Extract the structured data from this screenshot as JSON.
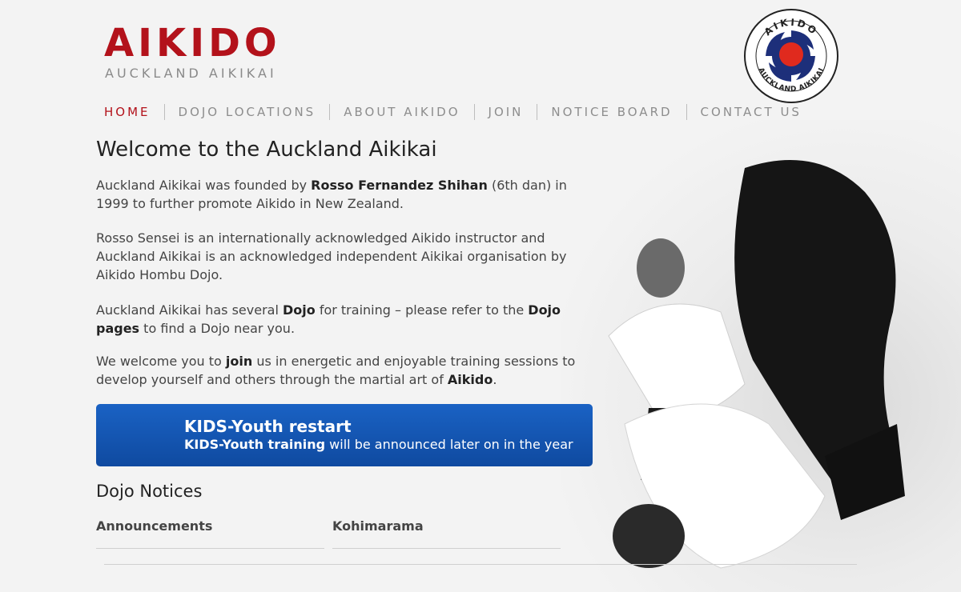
{
  "header": {
    "logo_title": "AIKIDO",
    "logo_subtitle": "AUCKLAND AIKIKAI",
    "emblem_top_text": "AIKIDO",
    "emblem_bottom_text": "AUCKLAND AIKIKAI"
  },
  "nav": {
    "items": [
      "HOME",
      "DOJO LOCATIONS",
      "ABOUT AIKIDO",
      "JOIN",
      "NOTICE BOARD",
      "CONTACT US"
    ],
    "active": "HOME"
  },
  "main": {
    "heading": "Welcome to the Auckland Aikikai",
    "p1": {
      "pre": "Auckland Aikikai was founded by ",
      "bold": "Rosso Fernandez Shihan",
      "post": " (6th dan) in 1999 to further promote Aikido in New Zealand."
    },
    "p2": "Rosso Sensei is an internationally acknowledged Aikido instructor and Auckland Aikikai is an acknowledged independent Aikikai organisation by Aikido Hombu Dojo.",
    "p3": {
      "a": "Auckland Aikikai has several ",
      "b1": "Dojo",
      "c": " for training – please refer to the ",
      "b2": "Dojo pages",
      "d": " to find a Dojo near you."
    },
    "p4": {
      "a": "We welcome you to ",
      "b1": "join",
      "c": " us in energetic and enjoyable training sessions to develop yourself and others through the martial art of ",
      "b2": "Aikido",
      "d": "."
    }
  },
  "banner": {
    "title": "KIDS-Youth restart",
    "text_bold": "KIDS-Youth training",
    "text_rest": " will be announced later on in the year"
  },
  "notices": {
    "heading": "Dojo Notices",
    "columns": [
      "Announcements",
      "Kohimarama"
    ]
  },
  "colors": {
    "brand_red": "#b3121b",
    "banner_blue": "#1a62c4",
    "emblem_blue": "#1d2f7a"
  }
}
